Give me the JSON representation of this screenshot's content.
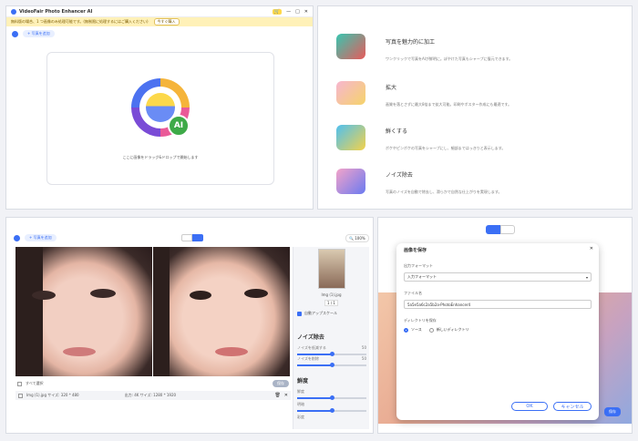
{
  "app": {
    "title": "VideoFair Photo Enhancer AI",
    "banner": "無料版の場合、1 つ画像のみ処理可能です。(無制限に処理するにはご購入ください)",
    "buy_label": "今すぐ購入"
  },
  "upload": {
    "add_label": "+ 写真を追加",
    "drop_hint": "ここに画像をドラッグ&ドロップで開始します",
    "ai_badge": "AI"
  },
  "features": [
    {
      "title": "写真を魅力的に加工",
      "desc": "ワンクリックで写真をAIが鮮明に。ぼやけた写真もシャープに復元できます。"
    },
    {
      "title": "拡大",
      "desc": "画質を落とさずに最大8倍まで拡大可能。印刷やポスター作成にも最適です。"
    },
    {
      "title": "鮮くする",
      "desc": "ボケやピンボケの写真をシャープにし、細部まではっきりと表示します。"
    },
    {
      "title": "ノイズ除去",
      "desc": "写真のノイズを自動で除去し、滑らかで自然な仕上がりを実現します。"
    }
  ],
  "editor": {
    "add_label": "+ 写真を追加",
    "zoom": "100%",
    "thumb_name": "Img (1).jpg",
    "page": "1 / 1",
    "auto_label": "自動アップスケール",
    "noise_title": "ノイズ除去",
    "noise_slider1": "ノイズを低減する",
    "noise_slider2": "ノイズを削除",
    "noise_val1": "50",
    "noise_val2": "50",
    "sharp_title": "鮮度",
    "sharp1": "鮮度",
    "sharp2": "明暗",
    "sharp3": "彩度",
    "select_all": "すべて選択",
    "file_info": "Img (1).jpg  サイズ: 320 * 480",
    "output_info": "出力: 4K サイズ: 1280 * 1920",
    "save_btn": "保存"
  },
  "dialog": {
    "title": "画像を保存",
    "format_label": "出力フォーマット",
    "format_value": "入力フォーマット",
    "filename_label": "ファイル名",
    "filename_value": "5a5e5a6c2a5b2a-PhotoEnhancer4",
    "dir_label": "ディレクトリを保存",
    "opt1": "ソース",
    "opt2": "新しいディレクトリ",
    "ok": "OK",
    "cancel": "キャンセル",
    "save_right": "保存"
  },
  "colors": {
    "accent": "#3b6ff5",
    "banner": "#fff1b8"
  }
}
